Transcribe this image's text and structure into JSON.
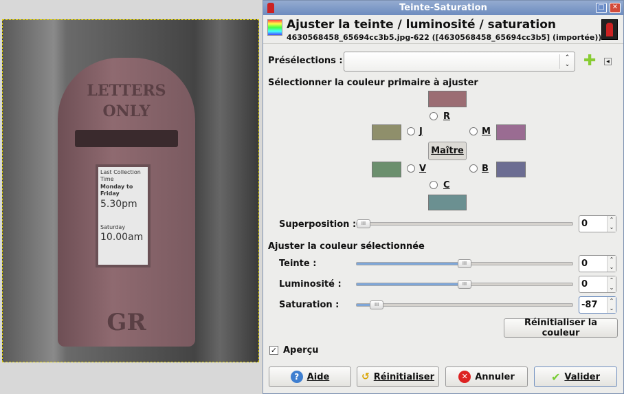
{
  "canvas": {
    "image": {
      "notice_lines": [
        "Last Collection Time",
        "Monday to Friday",
        "5.30pm",
        "Saturday",
        "10.00am"
      ],
      "box_text": [
        "LETTERS",
        "ONLY",
        "GR"
      ]
    }
  },
  "dialog": {
    "title": "Teinte-Saturation",
    "header_title": "Ajuster la teinte / luminosité / saturation",
    "header_subtitle": "4630568458_65694cc3b5.jpg-622 ([4630568458_65694cc3b5] (importée))",
    "presets_label": "Présélections :",
    "presets_value": "",
    "primary_section": "Sélectionner la couleur primaire à ajuster",
    "colors": {
      "R": {
        "label": "R",
        "hex": "#9b6d73"
      },
      "J": {
        "label": "J",
        "hex": "#8f8f6b"
      },
      "M": {
        "label": "M",
        "hex": "#9a6c92"
      },
      "V": {
        "label": "V",
        "hex": "#6b8f6d"
      },
      "B": {
        "label": "B",
        "hex": "#6c6d92"
      },
      "C": {
        "label": "C",
        "hex": "#6b9091"
      }
    },
    "master_label": "Maître",
    "overlap": {
      "label": "Superposition :",
      "value": "0",
      "fraction": 0
    },
    "adjust_section": "Ajuster la couleur sélectionnée",
    "hue": {
      "label": "Teinte :",
      "value": "0",
      "fraction": 0.5
    },
    "lightness": {
      "label": "Luminosité :",
      "value": "0",
      "fraction": 0.5
    },
    "saturation": {
      "label": "Saturation :",
      "value": "-87",
      "fraction": 0.065
    },
    "reset_color": "Réinitialiser la couleur",
    "preview_label": "Aperçu",
    "preview_checked": true,
    "buttons": {
      "help": "Aide",
      "reset": "Réinitialiser",
      "cancel": "Annuler",
      "ok": "Valider"
    }
  }
}
